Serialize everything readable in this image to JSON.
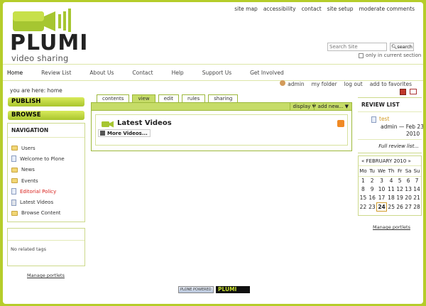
{
  "site_actions": [
    "site map",
    "accessibility",
    "contact",
    "site setup",
    "moderate comments"
  ],
  "logo": {
    "word": "PLUMI",
    "sub": "video sharing"
  },
  "search": {
    "placeholder": "Search Site",
    "button": "search",
    "option": "only in current section"
  },
  "global_nav": [
    "Home",
    "Review List",
    "About Us",
    "Contact",
    "Help",
    "Support Us",
    "Get Involved"
  ],
  "personal_bar": [
    "admin",
    "my folder",
    "log out",
    "add to favorites"
  ],
  "breadcrumb": {
    "label": "you are here:",
    "current": "home"
  },
  "left": {
    "publish": "PUBLISH",
    "browse": "BROWSE",
    "navigation": {
      "title": "NAVIGATION",
      "items": [
        {
          "label": "Users",
          "icon": "folder-icon"
        },
        {
          "label": "Welcome to Plone",
          "icon": "document-icon"
        },
        {
          "label": "News",
          "icon": "folder-icon"
        },
        {
          "label": "Events",
          "icon": "folder-icon"
        },
        {
          "label": "Editorial Policy",
          "icon": "document-icon"
        },
        {
          "label": "Latest Videos",
          "icon": "collection-icon"
        },
        {
          "label": "Browse Content",
          "icon": "folder-icon"
        }
      ]
    },
    "related": "No related tags",
    "manage": "Manage portlets"
  },
  "tabs": [
    {
      "label": "contents",
      "active": false
    },
    {
      "label": "view",
      "active": true
    },
    {
      "label": "edit",
      "active": false
    },
    {
      "label": "rules",
      "active": false
    },
    {
      "label": "sharing",
      "active": false
    }
  ],
  "content_menu": {
    "display": "display ▼",
    "add": "add new... ▼"
  },
  "content": {
    "title": "Latest Videos",
    "more": "More Videos..."
  },
  "review": {
    "title": "REVIEW LIST",
    "item_title": "test",
    "item_meta": "admin — Feb 23,",
    "item_year": "2010",
    "full": "Full review list..."
  },
  "calendar": {
    "title": "« FEBRUARY 2010 »",
    "days": [
      "Mo",
      "Tu",
      "We",
      "Th",
      "Fr",
      "Sa",
      "Su"
    ],
    "weeks": [
      [
        "1",
        "2",
        "3",
        "4",
        "5",
        "6",
        "7"
      ],
      [
        "8",
        "9",
        "10",
        "11",
        "12",
        "13",
        "14"
      ],
      [
        "15",
        "16",
        "17",
        "18",
        "19",
        "20",
        "21"
      ],
      [
        "22",
        "23",
        "24",
        "25",
        "26",
        "27",
        "28"
      ]
    ],
    "today": "24",
    "manage": "Manage portlets"
  },
  "footer": {
    "badge1": "PLONE POWERED",
    "badge2": "PLUMI"
  },
  "colors": {
    "accent": "#b5cd2a",
    "tab_active": "#c6dc68",
    "link_red": "#d9201c"
  }
}
